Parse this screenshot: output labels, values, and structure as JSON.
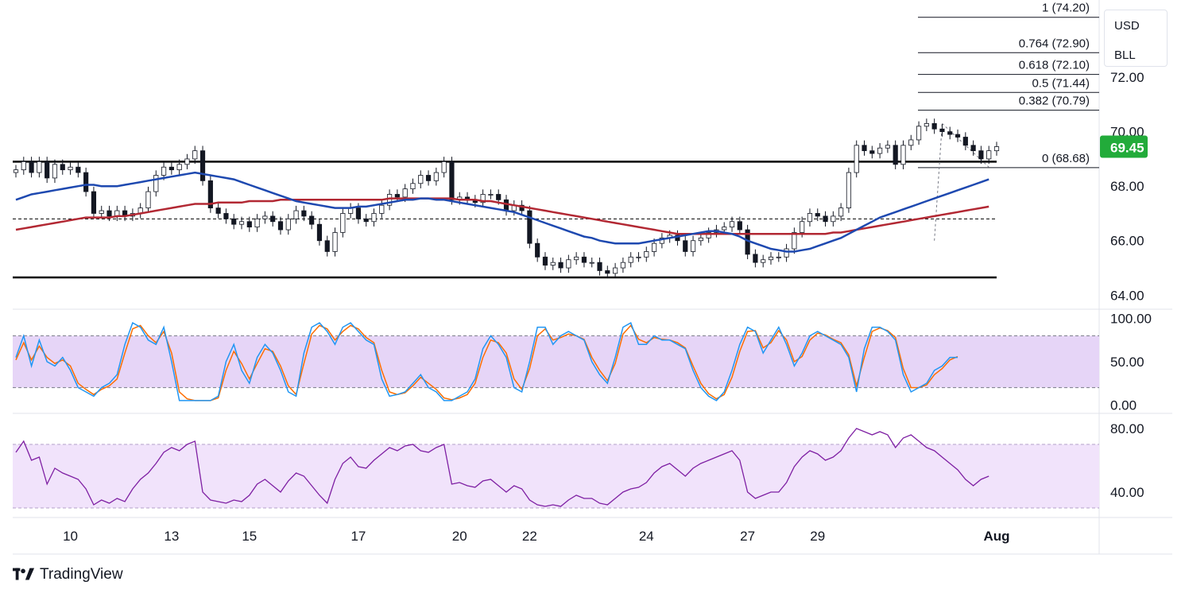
{
  "chart_data": {
    "type": "candlestick",
    "instrument": "BLL",
    "currency": "USD",
    "last_price": "69.45",
    "last_price_color": "#22ab3a",
    "price_axis": {
      "ticks": [
        "72.00",
        "70.00",
        "68.00",
        "66.00",
        "64.00"
      ],
      "range": [
        63.6,
        74.6
      ]
    },
    "x_ticks": [
      {
        "label": "10",
        "index": 7
      },
      {
        "label": "13",
        "index": 20
      },
      {
        "label": "15",
        "index": 30
      },
      {
        "label": "17",
        "index": 44
      },
      {
        "label": "20",
        "index": 57
      },
      {
        "label": "22",
        "index": 66
      },
      {
        "label": "24",
        "index": 81
      },
      {
        "label": "27",
        "index": 94
      },
      {
        "label": "29",
        "index": 103
      },
      {
        "label": "Aug",
        "index": 126,
        "bold": true
      }
    ],
    "close_series": [
      68.6,
      68.9,
      68.5,
      68.9,
      68.3,
      68.8,
      68.6,
      68.7,
      68.5,
      67.8,
      67.0,
      67.1,
      66.9,
      67.1,
      66.9,
      67.0,
      67.2,
      67.8,
      68.4,
      68.7,
      68.6,
      68.8,
      69.0,
      69.3,
      68.2,
      67.2,
      67.0,
      66.8,
      66.6,
      66.7,
      66.5,
      66.8,
      66.9,
      66.7,
      66.4,
      66.8,
      67.1,
      66.9,
      66.6,
      66.0,
      65.6,
      66.3,
      67.0,
      67.2,
      66.8,
      66.7,
      67.0,
      67.3,
      67.7,
      67.6,
      67.9,
      68.1,
      68.4,
      68.2,
      68.5,
      68.9,
      67.5,
      67.6,
      67.5,
      67.4,
      67.7,
      67.7,
      67.5,
      67.1,
      67.3,
      67.1,
      65.9,
      65.4,
      65.1,
      65.2,
      65.0,
      65.3,
      65.4,
      65.2,
      65.2,
      64.9,
      64.8,
      65.0,
      65.2,
      65.4,
      65.4,
      65.6,
      65.9,
      66.1,
      66.2,
      66.0,
      65.6,
      66.0,
      66.1,
      66.3,
      66.4,
      66.5,
      66.7,
      66.4,
      65.5,
      65.2,
      65.3,
      65.4,
      65.4,
      65.7,
      66.3,
      66.7,
      67.0,
      66.9,
      66.7,
      66.9,
      67.2,
      68.5,
      69.5,
      69.3,
      69.2,
      69.4,
      69.5,
      68.8,
      69.5,
      69.7,
      70.2,
      70.3,
      70.1,
      70.0,
      69.9,
      69.8,
      69.5,
      69.3,
      69.0,
      69.3,
      69.45
    ],
    "sma_blue": {
      "color": "#1e49b0",
      "values": [
        67.5,
        67.6,
        67.7,
        67.75,
        67.8,
        67.85,
        67.9,
        67.95,
        68.0,
        68.05,
        68.05,
        68.0,
        68.0,
        68.0,
        68.05,
        68.1,
        68.15,
        68.2,
        68.25,
        68.3,
        68.35,
        68.4,
        68.45,
        68.5,
        68.45,
        68.4,
        68.35,
        68.3,
        68.25,
        68.15,
        68.05,
        67.95,
        67.85,
        67.75,
        67.65,
        67.55,
        67.45,
        67.4,
        67.35,
        67.3,
        67.25,
        67.2,
        67.2,
        67.2,
        67.25,
        67.25,
        67.3,
        67.35,
        67.4,
        67.45,
        67.5,
        67.5,
        67.55,
        67.55,
        67.5,
        67.5,
        67.45,
        67.4,
        67.35,
        67.3,
        67.25,
        67.2,
        67.15,
        67.1,
        67.05,
        66.95,
        66.85,
        66.75,
        66.65,
        66.55,
        66.45,
        66.35,
        66.25,
        66.15,
        66.1,
        66.0,
        65.95,
        65.9,
        65.9,
        65.9,
        65.9,
        65.95,
        66.0,
        66.05,
        66.1,
        66.15,
        66.2,
        66.25,
        66.3,
        66.35,
        66.35,
        66.3,
        66.25,
        66.15,
        66.0,
        65.9,
        65.8,
        65.7,
        65.65,
        65.6,
        65.6,
        65.65,
        65.7,
        65.8,
        65.9,
        66.0,
        66.1,
        66.25,
        66.4,
        66.55,
        66.7,
        66.85,
        66.95,
        67.05,
        67.15,
        67.25,
        67.35,
        67.45,
        67.55,
        67.65,
        67.75,
        67.85,
        67.95,
        68.05,
        68.15,
        68.25
      ]
    },
    "sma_red": {
      "color": "#b22833",
      "values": [
        66.4,
        66.45,
        66.5,
        66.55,
        66.6,
        66.65,
        66.7,
        66.75,
        66.8,
        66.85,
        66.85,
        66.85,
        66.85,
        66.9,
        66.9,
        66.95,
        67.0,
        67.05,
        67.1,
        67.15,
        67.2,
        67.25,
        67.3,
        67.35,
        67.35,
        67.35,
        67.4,
        67.4,
        67.4,
        67.4,
        67.45,
        67.45,
        67.45,
        67.45,
        67.5,
        67.5,
        67.5,
        67.5,
        67.5,
        67.5,
        67.5,
        67.5,
        67.5,
        67.5,
        67.5,
        67.5,
        67.5,
        67.5,
        67.55,
        67.55,
        67.55,
        67.55,
        67.55,
        67.55,
        67.55,
        67.55,
        67.55,
        67.5,
        67.5,
        67.5,
        67.45,
        67.45,
        67.4,
        67.35,
        67.3,
        67.25,
        67.2,
        67.15,
        67.1,
        67.05,
        67.0,
        66.95,
        66.9,
        66.85,
        66.8,
        66.75,
        66.7,
        66.65,
        66.6,
        66.55,
        66.5,
        66.45,
        66.4,
        66.35,
        66.3,
        66.25,
        66.25,
        66.25,
        66.25,
        66.25,
        66.25,
        66.25,
        66.25,
        66.25,
        66.25,
        66.25,
        66.25,
        66.25,
        66.25,
        66.25,
        66.25,
        66.25,
        66.25,
        66.25,
        66.25,
        66.3,
        66.3,
        66.35,
        66.4,
        66.45,
        66.5,
        66.55,
        66.6,
        66.65,
        66.7,
        66.75,
        66.8,
        66.85,
        66.9,
        66.95,
        67.0,
        67.05,
        67.1,
        67.15,
        67.2,
        67.25
      ]
    },
    "levels": [
      {
        "name": "resistance",
        "value": 68.9,
        "style": "solid",
        "from": 0,
        "to": 126
      },
      {
        "name": "support",
        "value": 64.65,
        "style": "solid",
        "from": 0,
        "to": 126
      },
      {
        "name": "midline",
        "value": 66.8,
        "style": "dashed",
        "from": 0,
        "to": 126
      }
    ],
    "fibonacci": {
      "from_index": 118,
      "to_index": 140,
      "levels": [
        {
          "label": "1 (74.20)",
          "value": 74.2
        },
        {
          "label": "0.764 (72.90)",
          "value": 72.9
        },
        {
          "label": "0.618 (72.10)",
          "value": 72.1
        },
        {
          "label": "0.5 (71.44)",
          "value": 71.44
        },
        {
          "label": "0.382 (70.79)",
          "value": 70.79
        },
        {
          "label": "0 (68.68)",
          "value": 68.68
        }
      ]
    },
    "stoch": {
      "ticks": [
        "100.00",
        "50.00",
        "0.00"
      ],
      "range": [
        -8,
        108
      ],
      "band": [
        20,
        80
      ],
      "k_color": "#2196f3",
      "d_color": "#ff6d00",
      "k": [
        55,
        80,
        45,
        75,
        50,
        45,
        55,
        40,
        20,
        15,
        10,
        20,
        25,
        35,
        70,
        95,
        90,
        75,
        70,
        90,
        50,
        5,
        5,
        5,
        5,
        5,
        10,
        50,
        70,
        40,
        25,
        55,
        70,
        60,
        40,
        15,
        10,
        60,
        90,
        95,
        85,
        70,
        90,
        95,
        85,
        75,
        70,
        30,
        10,
        12,
        15,
        25,
        35,
        20,
        15,
        5,
        5,
        10,
        15,
        30,
        65,
        80,
        70,
        55,
        20,
        15,
        50,
        90,
        90,
        70,
        80,
        85,
        80,
        75,
        50,
        35,
        25,
        55,
        90,
        95,
        70,
        70,
        80,
        75,
        75,
        70,
        65,
        40,
        20,
        10,
        5,
        15,
        40,
        70,
        90,
        85,
        60,
        75,
        90,
        70,
        45,
        60,
        80,
        85,
        80,
        75,
        70,
        55,
        15,
        65,
        90,
        90,
        85,
        75,
        35,
        15,
        20,
        25,
        40,
        45,
        55,
        55
      ],
      "d": [
        52,
        72,
        52,
        68,
        55,
        48,
        52,
        45,
        25,
        18,
        12,
        18,
        22,
        30,
        60,
        88,
        92,
        80,
        72,
        85,
        60,
        15,
        7,
        5,
        5,
        5,
        8,
        40,
        62,
        48,
        30,
        48,
        65,
        62,
        45,
        22,
        12,
        48,
        82,
        92,
        88,
        75,
        85,
        92,
        88,
        78,
        72,
        40,
        15,
        12,
        14,
        22,
        32,
        25,
        18,
        8,
        6,
        8,
        12,
        25,
        55,
        75,
        72,
        60,
        30,
        18,
        42,
        80,
        88,
        75,
        78,
        82,
        80,
        76,
        55,
        40,
        28,
        48,
        82,
        92,
        76,
        72,
        78,
        76,
        75,
        72,
        66,
        45,
        25,
        13,
        7,
        12,
        32,
        62,
        85,
        86,
        66,
        72,
        86,
        75,
        50,
        56,
        75,
        83,
        81,
        76,
        72,
        58,
        22,
        55,
        85,
        89,
        86,
        78,
        42,
        20,
        20,
        23,
        35,
        42,
        52,
        56
      ]
    },
    "rsi": {
      "ticks": [
        "80.00",
        "40.00"
      ],
      "range": [
        25,
        88
      ],
      "band": [
        30,
        70
      ],
      "color": "#7e1fa3",
      "values": [
        65,
        72,
        60,
        62,
        45,
        55,
        52,
        50,
        48,
        42,
        32,
        35,
        33,
        36,
        34,
        42,
        48,
        52,
        58,
        65,
        68,
        66,
        70,
        72,
        40,
        35,
        34,
        33,
        35,
        34,
        38,
        45,
        48,
        44,
        40,
        47,
        52,
        50,
        44,
        38,
        33,
        48,
        58,
        62,
        56,
        55,
        60,
        64,
        68,
        66,
        69,
        70,
        66,
        65,
        68,
        70,
        45,
        46,
        44,
        43,
        47,
        48,
        44,
        40,
        44,
        42,
        35,
        32,
        31,
        32,
        31,
        35,
        38,
        36,
        36,
        33,
        32,
        36,
        40,
        42,
        43,
        46,
        52,
        56,
        58,
        54,
        50,
        55,
        58,
        60,
        62,
        64,
        66,
        60,
        40,
        36,
        38,
        40,
        40,
        46,
        56,
        62,
        66,
        64,
        60,
        62,
        66,
        74,
        80,
        78,
        76,
        78,
        76,
        68,
        74,
        76,
        72,
        68,
        66,
        62,
        58,
        54,
        48,
        44,
        48,
        50
      ]
    }
  },
  "watermark": {
    "text": "TradingView"
  }
}
